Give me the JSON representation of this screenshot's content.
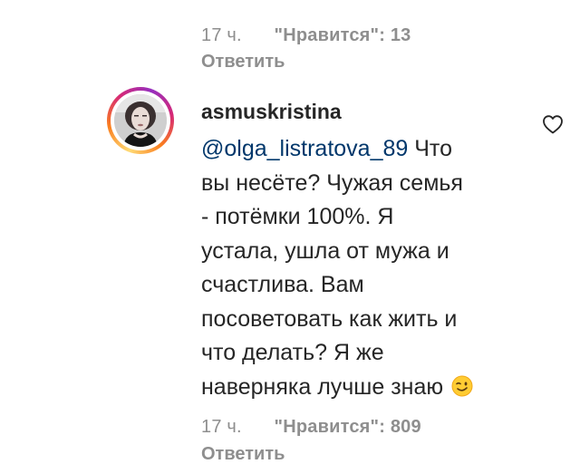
{
  "previous_comment": {
    "time": "17 ч.",
    "likes": "\"Нравится\": 13",
    "reply": "Ответить"
  },
  "comment": {
    "username": "asmuskristina",
    "mention": "@olga_listratova_89",
    "lines": [
      " Что",
      "вы несёте? Чужая семья",
      "- потёмки 100%. Я",
      "устала, ушла от мужа и",
      "счастлива. Вам",
      "посоветовать как жить и",
      "что делать? Я же",
      "наверняка лучше знаю"
    ],
    "emoji_icon": "winking-face-icon",
    "time": "17 ч.",
    "likes": "\"Нравится\": 809",
    "reply": "Ответить",
    "like_icon": "heart-outline-icon"
  },
  "colors": {
    "text": "#262626",
    "secondary": "#8e8e8e",
    "mention": "#00376b"
  }
}
